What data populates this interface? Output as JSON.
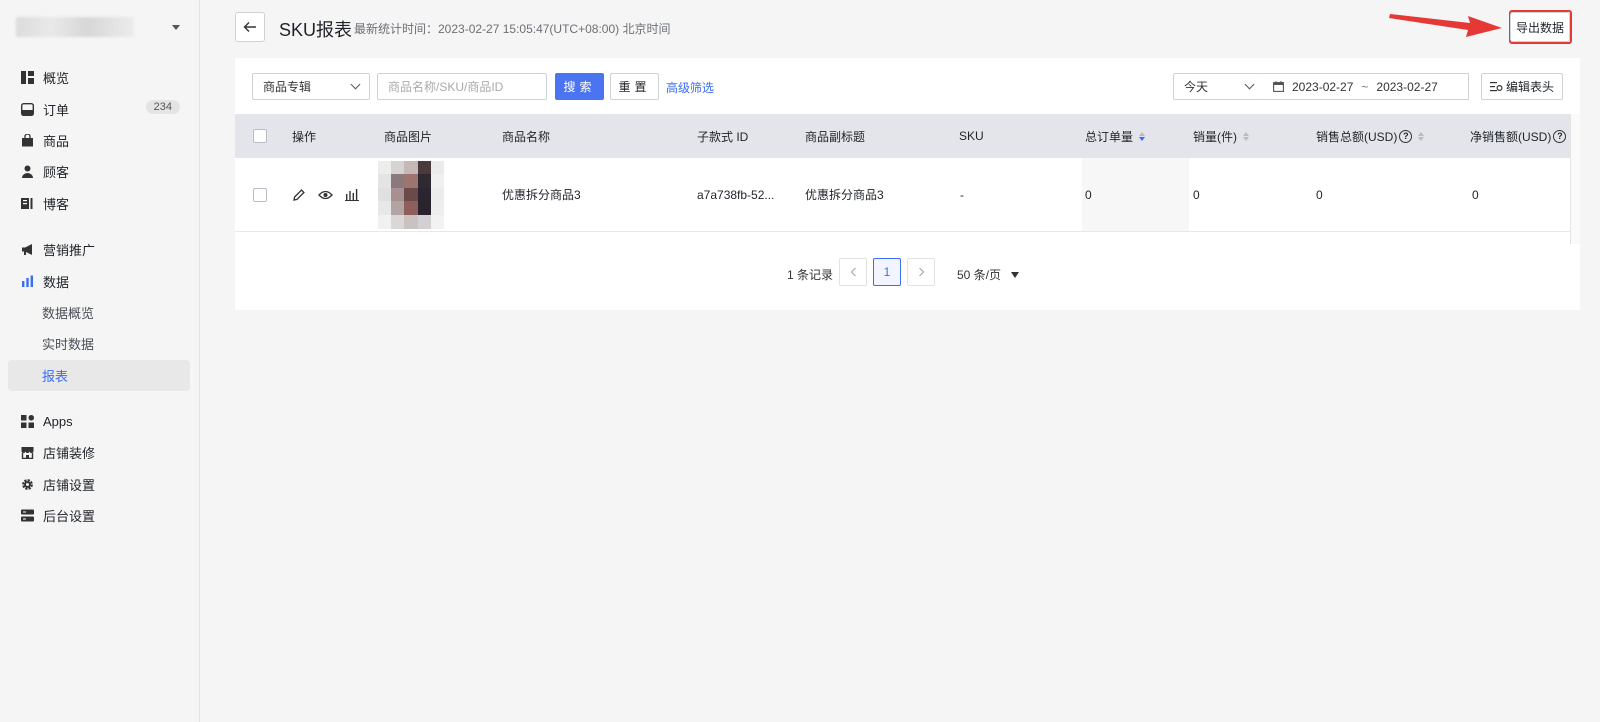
{
  "sidebar": {
    "items": [
      {
        "label": "概览",
        "icon": "overview-icon"
      },
      {
        "label": "订单",
        "icon": "order-icon",
        "count": "234"
      },
      {
        "label": "商品",
        "icon": "product-icon"
      },
      {
        "label": "顾客",
        "icon": "customer-icon"
      },
      {
        "label": "博客",
        "icon": "blog-icon"
      },
      {
        "label": "营销推广",
        "icon": "megaphone-icon"
      },
      {
        "label": "数据",
        "icon": "bar-chart-icon"
      },
      {
        "label": "数据概览"
      },
      {
        "label": "实时数据"
      },
      {
        "label": "报表"
      },
      {
        "label": "Apps",
        "icon": "apps-icon"
      },
      {
        "label": "店铺装修",
        "icon": "store-icon"
      },
      {
        "label": "店铺设置",
        "icon": "gear-icon"
      },
      {
        "label": "后台设置",
        "icon": "server-icon"
      }
    ]
  },
  "header": {
    "title": "SKU报表",
    "subtitle": "最新统计时间：2023-02-27 15:05:47(UTC+08:00) 北京时间",
    "export_label": "导出数据"
  },
  "filters": {
    "collection_select": "商品专辑",
    "search_placeholder": "商品名称/SKU/商品ID",
    "search_label": "搜索",
    "reset_label": "重置",
    "advanced_label": "高级筛选",
    "period_select": "今天",
    "date_start": "2023-02-27",
    "date_sep": "~",
    "date_end": "2023-02-27",
    "edit_columns_label": "编辑表头"
  },
  "table": {
    "headers": {
      "actions": "操作",
      "image": "商品图片",
      "name": "商品名称",
      "variant_id": "子款式 ID",
      "subtitle": "商品副标题",
      "sku": "SKU",
      "total_orders": "总订单量",
      "units": "销量(件)",
      "gross_sales": "销售总额(USD)",
      "net_sales": "净销售额(USD)"
    },
    "rows": [
      {
        "name": "优惠拆分商品3",
        "variant_id": "a7a738fb-52...",
        "subtitle": "优惠拆分商品3",
        "sku": "-",
        "total_orders": "0",
        "units": "0",
        "gross_sales": "0",
        "net_sales": "0"
      }
    ]
  },
  "pagination": {
    "total_label": "1 条记录",
    "current_page": "1",
    "page_size_label": "50 条/页"
  },
  "colors": {
    "accent": "#4a74f0",
    "highlight": "#e53935"
  }
}
